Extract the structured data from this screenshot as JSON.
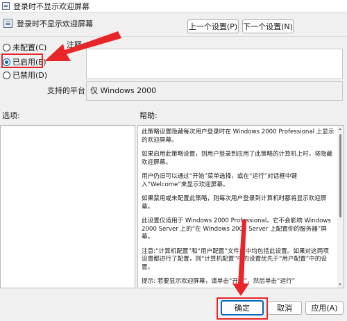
{
  "window": {
    "title": "登录时不显示欢迎屏幕"
  },
  "header": {
    "policy_title": "登录时不显示欢迎屏幕"
  },
  "nav": {
    "prev_label": "上一个设置(P)",
    "next_label": "下一个设置(N)"
  },
  "state": {
    "options": [
      {
        "label": "未配置(C)",
        "selected": false
      },
      {
        "label": "已启用(E)",
        "selected": true
      },
      {
        "label": "已禁用(D)",
        "selected": false
      }
    ]
  },
  "comment": {
    "label": "注释:",
    "value": ""
  },
  "platform": {
    "label": "支持的平台:",
    "value": "仅 Windows 2000"
  },
  "panes": {
    "options_label": "选项:",
    "help_label": "帮助:"
  },
  "help": {
    "paragraphs": [
      "此策略设置隐藏每次用户登录时在 Windows 2000 Professional 上显示的欢迎屏幕。",
      "如果启用此策略设置，则用户登录到应用了此策略的计算机上时，将隐藏欢迎屏幕。",
      "用户仍旧可以通过“开始”菜单选择，或在“运行”对话框中键入“Welcome”来显示欢迎屏幕。",
      "如果禁用或未配置此策略，则每次用户登录到计算机时都将显示欢迎屏幕。",
      "此设置仅适用于 Windows 2000 Professional。它不会影响 Windows 2000 Server 上的“在 Windows 2000 Server 上配置你的服务器”屏幕。",
      "注意:“计算机配置”和“用户配置”文件夹中均包括此设置。如果对这两项设置都进行了配置，则“计算机配置”中的设置优先于“用户配置”中的设置。",
      "提示: 若要显示欢迎屏幕，请单击“开始”，然后单击“运行”"
    ]
  },
  "footer": {
    "ok_label": "确定",
    "cancel_label": "取消",
    "apply_label": "应用(A)"
  },
  "colors": {
    "annotation": "#e8262a",
    "accent": "#0067c0"
  }
}
